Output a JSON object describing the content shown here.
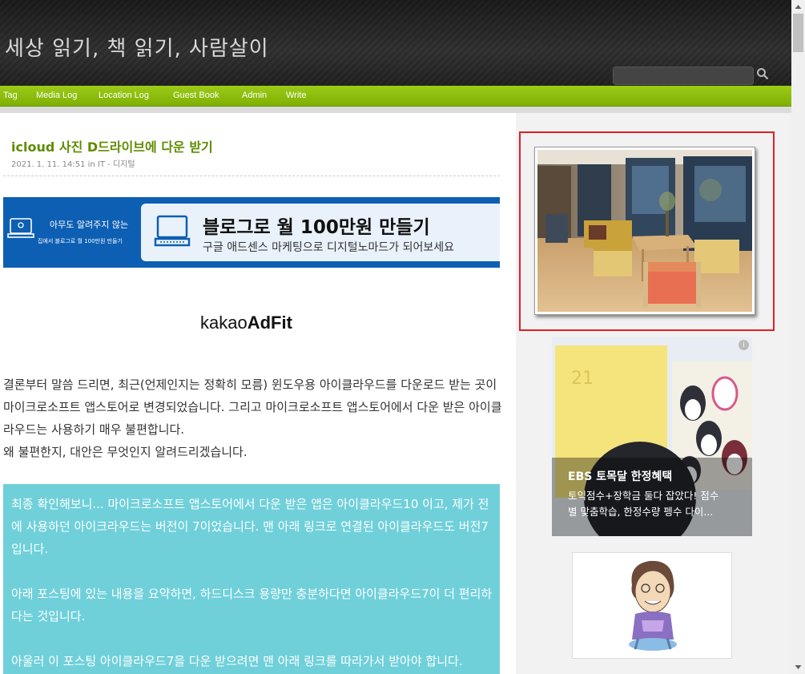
{
  "header": {
    "site_title": "세상 읽기, 책 읽기, 사람살이",
    "search_placeholder": ""
  },
  "nav": [
    "Tag",
    "Media Log",
    "Location Log",
    "Guest Book",
    "Admin",
    "Write"
  ],
  "post": {
    "title": "icloud 사진 D드라이브에 다운 받기",
    "meta": "2021. 1. 11. 14:51 in IT - 디지털"
  },
  "banner": {
    "left_line1": "아무도 알려주지 않는",
    "left_line2": "집에서 블로그로 월 100만원 만들기",
    "title": "블로그로 월 100만원 만들기",
    "subtitle": "구글 애드센스 마케팅으로 디지털노마드가 되어보세요"
  },
  "adfit": {
    "kakao": "kakao",
    "adfit": "AdFit"
  },
  "body": {
    "p1": "결론부터 말씀 드리면, 최근(언제인지는 정확히 모름) 윈도우용 아이클라우드를 다운로드 받는 곳이 마이크로소프트 앱스토어로 변경되었습니다. 그리고 마이크로소프트 앱스토어에서 다운 받은 아이클라우드는 사용하기 매우 불편합니다.",
    "p2": "왜 불편한지, 대안은 무엇인지 알려드리겠습니다."
  },
  "highlight": {
    "p1": "최종 확인해보니... 마이크로소프트 앱스토어에서 다운 받은 앱은 아이클라우드10 이고, 제가 전에 사용하던 아이크라우드는 버전이 7이었습니다.  맨 아래 링크로 연결된 아이클라우드도 버전7 입니다.",
    "p2": "아래 포스팅에 있는 내용을 요약하면, 하드디스크 용량만 충분하다면 아이클라우드7이 더 편리하다는 것입니다.",
    "p3": "아울러 이 포스팅 아이클라우드7을 다운 받으려면 맨 아래 링크를 따라가서 받아야 합니다."
  },
  "ad": {
    "info": "i",
    "title": "EBS 토목달 한정혜택",
    "desc_line1": "토익점수+장학금 둘다 잡았다! 점수",
    "desc_line2": "별 맞춤학습, 한정수량 펭수 다이..."
  },
  "colors": {
    "nav_green": "#8fbf0f",
    "title_green": "#5f8c00",
    "highlight_bg": "#6fd0da",
    "frame_red": "#e21e25"
  }
}
